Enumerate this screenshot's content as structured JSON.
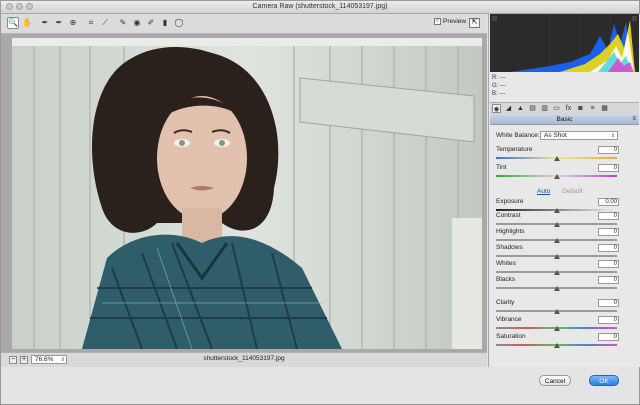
{
  "window": {
    "title": "Camera Raw (shutterstock_114053197.jpg)"
  },
  "toolbar": {
    "tools": [
      {
        "name": "zoom-tool",
        "glyph": "🔍"
      },
      {
        "name": "hand-tool",
        "glyph": "✋"
      },
      {
        "name": "white-balance-tool",
        "glyph": "✒"
      },
      {
        "name": "color-sampler-tool",
        "glyph": "✒"
      },
      {
        "name": "targeted-adjustment-tool",
        "glyph": "⊕"
      },
      {
        "name": "crop-tool",
        "glyph": "⌗"
      },
      {
        "name": "straighten-tool",
        "glyph": "⟋"
      },
      {
        "name": "spot-removal-tool",
        "glyph": "✎"
      },
      {
        "name": "red-eye-tool",
        "glyph": "◉"
      },
      {
        "name": "adjustment-brush-tool",
        "glyph": "✐"
      },
      {
        "name": "graduated-filter-tool",
        "glyph": "▮"
      },
      {
        "name": "radial-filter-tool",
        "glyph": "◯"
      }
    ],
    "preview_label": "Preview",
    "preview_checked": "✓",
    "fullscreen_glyph": "⇱"
  },
  "bottom": {
    "zoom_out": "−",
    "zoom_in": "+",
    "zoom_value": "76.6%",
    "zoom_arrow": "⇕",
    "filename": "shutterstock_114053197.jpg"
  },
  "readout": {
    "r": "R:  ---",
    "g": "G:  ---",
    "b": "B:  ---"
  },
  "tabs": [
    {
      "name": "basic-tab",
      "glyph": "◉"
    },
    {
      "name": "tone-curve-tab",
      "glyph": "◢"
    },
    {
      "name": "detail-tab",
      "glyph": "▲"
    },
    {
      "name": "hsl-tab",
      "glyph": "▤"
    },
    {
      "name": "split-toning-tab",
      "glyph": "▥"
    },
    {
      "name": "lens-corrections-tab",
      "glyph": "▭"
    },
    {
      "name": "effects-tab",
      "glyph": "fx"
    },
    {
      "name": "camera-calibration-tab",
      "glyph": "◙"
    },
    {
      "name": "presets-tab",
      "glyph": "≡"
    },
    {
      "name": "snapshots-tab",
      "glyph": "▦"
    }
  ],
  "basic": {
    "section_title": "Basic",
    "menu_glyph": "≡",
    "white_balance_label": "White Balance:",
    "white_balance_value": "As Shot",
    "select_arrow": "⇕",
    "auto": "Auto",
    "default": "Default",
    "sliders": [
      {
        "key": "temperature",
        "label": "Temperature",
        "value": "0",
        "level": 0.5
      },
      {
        "key": "tint",
        "label": "Tint",
        "value": "0",
        "level": 0.5
      },
      {
        "key": "exposure",
        "label": "Exposure",
        "value": "0.00",
        "level": 0.5
      },
      {
        "key": "contrast",
        "label": "Contrast",
        "value": "0",
        "level": 0.5
      },
      {
        "key": "highlights",
        "label": "Highlights",
        "value": "0",
        "level": 0.5
      },
      {
        "key": "shadows",
        "label": "Shadows",
        "value": "0",
        "level": 0.5
      },
      {
        "key": "whites",
        "label": "Whites",
        "value": "0",
        "level": 0.5
      },
      {
        "key": "blacks",
        "label": "Blacks",
        "value": "0",
        "level": 0.5
      },
      {
        "key": "clarity",
        "label": "Clarity",
        "value": "0",
        "level": 0.5
      },
      {
        "key": "vibrance",
        "label": "Vibrance",
        "value": "0",
        "level": 0.5
      },
      {
        "key": "saturation",
        "label": "Saturation",
        "value": "0",
        "level": 0.5
      }
    ]
  },
  "buttons": {
    "cancel": "Cancel",
    "ok": "OK"
  },
  "colors": {
    "accent": "#2a7ee6",
    "section_header": "#b9c6da"
  }
}
